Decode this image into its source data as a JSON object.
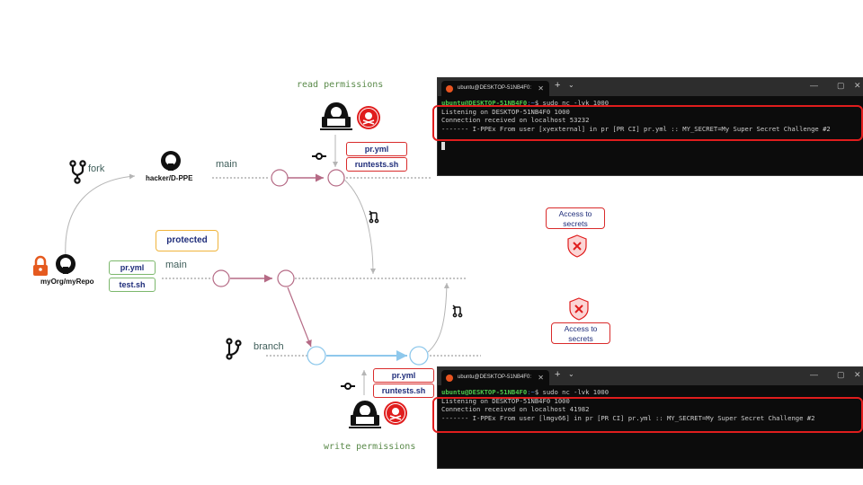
{
  "diagram": {
    "repos": {
      "origin": "myOrg/myRepo",
      "fork": "hacker/D-PPE"
    },
    "labels": {
      "fork": "fork",
      "branch": "branch",
      "main_top": "main",
      "main_bottom": "main",
      "protected": "protected",
      "read_permissions": "read permissions",
      "write_permissions": "write permissions"
    },
    "origin_files": [
      "pr.yml",
      "test.sh"
    ],
    "attacker_files_read": [
      "pr.yml",
      "runtests.sh"
    ],
    "attacker_files_write": [
      "pr.yml",
      "runtests.sh"
    ],
    "callouts": {
      "top": "Access to secrets",
      "bottom": "Access to secrets"
    },
    "colors": {
      "main_branch": "#b56a85",
      "feature_branch": "#8ec8ec",
      "danger": "#e01d1d",
      "protected": "#f0b43c",
      "file_ok": "#7cb86c"
    }
  },
  "terminals": [
    {
      "tab_title": "ubuntu@DESKTOP-51NB4F0:",
      "prompt_user": "ubuntu@DESKTOP-51NB4F0",
      "prompt_path": ":~",
      "prompt_symbol": "$ ",
      "command": "sudo nc -lvk 1000",
      "lines": [
        "Listening on DESKTOP-51NB4F0 1000",
        "Connection received on localhost 53232",
        "------- I-PPEx From user [xyexternal] in pr [PR CI] pr.yml :: MY_SECRET=My Super Secret Challenge #2"
      ]
    },
    {
      "tab_title": "ubuntu@DESKTOP-51NB4F0:",
      "prompt_user": "ubuntu@DESKTOP-51NB4F0",
      "prompt_path": ":~",
      "prompt_symbol": "$ ",
      "command": "sudo nc -lvk 1000",
      "lines": [
        "Listening on DESKTOP-51NB4F0 1000",
        "Connection received on localhost 41982",
        "------- I-PPEx From user [lmgv66] in pr [PR CI] pr.yml :: MY_SECRET=My Super Secret Challenge #2"
      ]
    }
  ]
}
